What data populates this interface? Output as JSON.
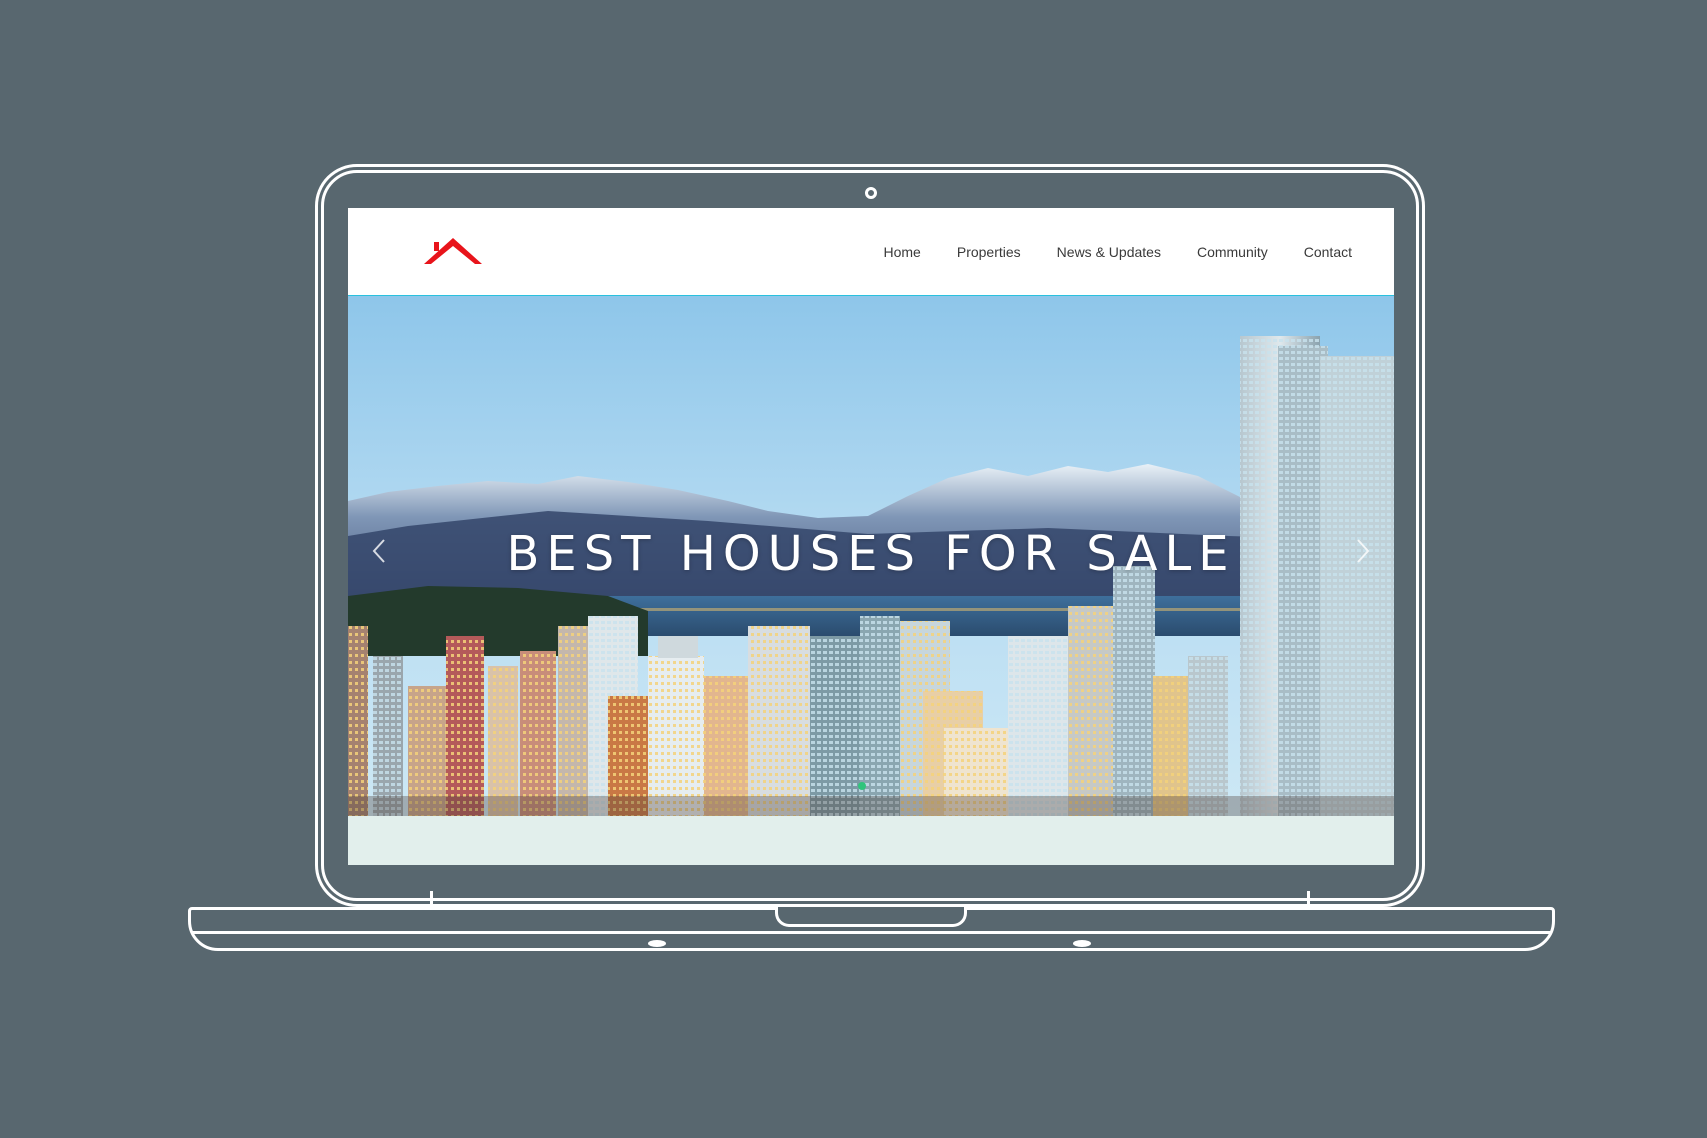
{
  "nav": {
    "items": [
      {
        "label": "Home"
      },
      {
        "label": "Properties"
      },
      {
        "label": "News & Updates"
      },
      {
        "label": "Community"
      },
      {
        "label": "Contact"
      }
    ]
  },
  "hero": {
    "title": "BEST HOUSES FOR SALE",
    "active_slide": 1
  },
  "section": {
    "heading": ""
  },
  "colors": {
    "backdrop": "#58676f",
    "logo_red": "#e8141b",
    "header_rule": "#29c1de",
    "section_band": "#e2efec",
    "active_dot": "#30c47c"
  },
  "icons": {
    "logo": "house-roof-icon",
    "prev": "chevron-left-icon",
    "next": "chevron-right-icon"
  }
}
